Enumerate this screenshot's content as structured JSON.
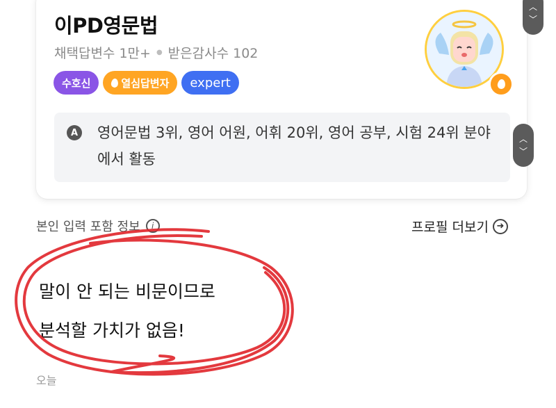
{
  "profile": {
    "name": "이PD영문법",
    "adopted_label": "채택답변수 1만+",
    "thanks_label": "받은감사수 102",
    "badges": {
      "guardian": "수호신",
      "passionate": "열심답변자",
      "expert": "expert"
    },
    "fields_text": "영어문법 3위, 영어 어원, 어휘 20위, 영어 공부, 시험 24위 분야에서 활동"
  },
  "section": {
    "info_label": "본인 입력 포함 정보",
    "more_label": "프로필 더보기"
  },
  "answer": {
    "line1": "말이 안 되는 비문이므로",
    "line2": "분석할 가치가 없음!",
    "date": "오늘"
  },
  "colors": {
    "guardian": "#8a55e6",
    "passionate": "#ffa523",
    "expert": "#3f6ff2",
    "scribble": "#e0242a"
  },
  "icons": [
    "fire-icon",
    "answer-a-icon",
    "info-icon",
    "arrow-right-icon",
    "chevron-up-icon",
    "chevron-down-icon"
  ]
}
